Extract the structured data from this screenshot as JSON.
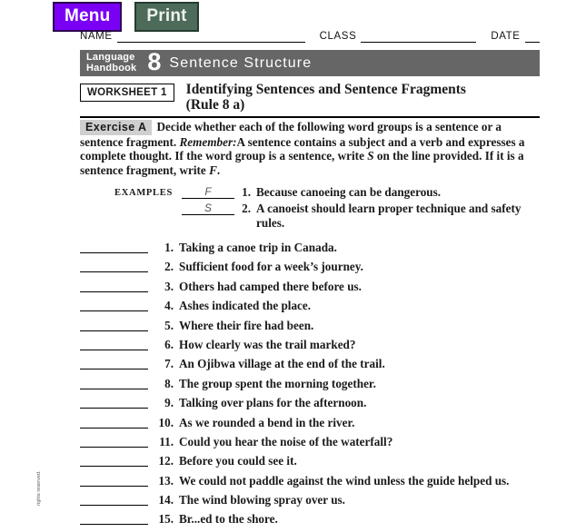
{
  "toolbar": {
    "menu_label": "Menu",
    "print_label": "Print",
    "menu_color": "#7a00f5",
    "print_color": "#4c6b58"
  },
  "form_fields": {
    "name_label": "NAME",
    "class_label": "CLASS",
    "date_label": "DATE",
    "name_value": "",
    "class_value": "",
    "date_value": ""
  },
  "banner": {
    "book_line1": "Language",
    "book_line2": "Handbook",
    "number": "8",
    "title": "Sentence Structure",
    "background": "#666666"
  },
  "worksheet": {
    "badge": "WORKSHEET 1",
    "title": "Identifying Sentences and Sentence Fragments",
    "rule": "(Rule 8 a)"
  },
  "exercise": {
    "tag": "Exercise A",
    "instructions_part1": "Decide whether each of the following word groups is a sentence or a sentence fragment.",
    "remember_label": "Remember:",
    "instructions_part2": "A sentence contains a subject and a verb and expresses a complete thought. If the word group is a sentence, write",
    "answer_s": "S",
    "instructions_part3": "on the line provided. If it is a sentence fragment, write",
    "answer_f": "F",
    "period": "."
  },
  "examples": {
    "label": "EXAMPLES",
    "rows": [
      {
        "answer": "F",
        "num": "1.",
        "text": "Because canoeing can be dangerous."
      },
      {
        "answer": "S",
        "num": "2.",
        "text": "A canoeist should learn proper technique and safety rules."
      }
    ]
  },
  "items": [
    {
      "num": "1.",
      "text": "Taking a canoe trip in Canada.",
      "answer": ""
    },
    {
      "num": "2.",
      "text": "Sufficient food for a week’s journey.",
      "answer": ""
    },
    {
      "num": "3.",
      "text": "Others had camped there before us.",
      "answer": ""
    },
    {
      "num": "4.",
      "text": "Ashes indicated the place.",
      "answer": ""
    },
    {
      "num": "5.",
      "text": "Where their fire had been.",
      "answer": ""
    },
    {
      "num": "6.",
      "text": "How clearly was the trail marked?",
      "answer": ""
    },
    {
      "num": "7.",
      "text": "An Ojibwa village at the end of the trail.",
      "answer": ""
    },
    {
      "num": "8.",
      "text": "The group spent the morning together.",
      "answer": ""
    },
    {
      "num": "9.",
      "text": "Talking over plans for the afternoon.",
      "answer": ""
    },
    {
      "num": "10.",
      "text": "As we rounded a bend in the river.",
      "answer": ""
    },
    {
      "num": "11.",
      "text": "Could you hear the noise of the waterfall?",
      "answer": ""
    },
    {
      "num": "12.",
      "text": "Before you could see it.",
      "answer": ""
    },
    {
      "num": "13.",
      "text": "We could not paddle against the wind unless the guide helped us.",
      "answer": ""
    },
    {
      "num": "14.",
      "text": "The wind blowing spray over us.",
      "answer": ""
    },
    {
      "num": "15.",
      "text": "Br...ed to the shore.",
      "answer": ""
    }
  ],
  "copyright": "rights reserved."
}
